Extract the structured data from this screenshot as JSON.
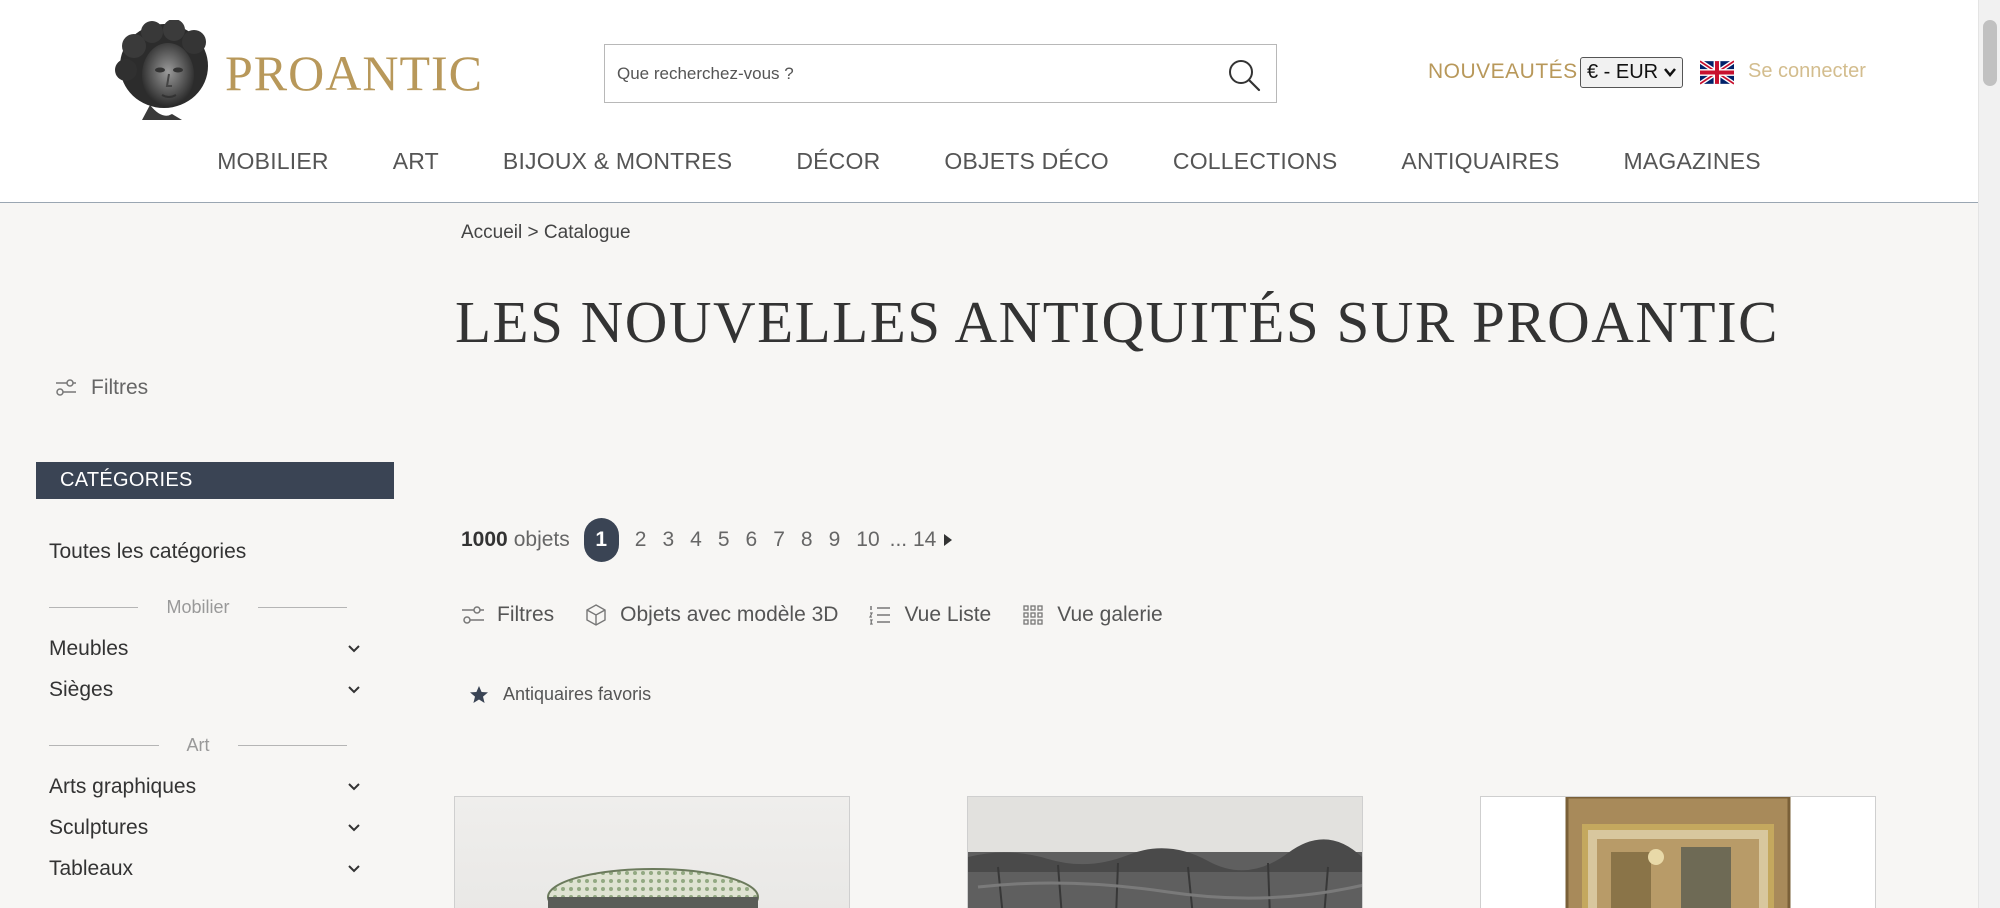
{
  "header": {
    "logo_text": "PROANTIC",
    "search_placeholder": "Que recherchez-vous ?",
    "nouveautes": "NOUVEAUTÉS",
    "currency": "€ - EUR",
    "signin": "Se connecter",
    "accent_color": "#b8985a"
  },
  "nav": [
    "MOBILIER",
    "ART",
    "BIJOUX & MONTRES",
    "DÉCOR",
    "OBJETS DÉCO",
    "COLLECTIONS",
    "ANTIQUAIRES",
    "MAGAZINES"
  ],
  "breadcrumb": "Accueil > Catalogue",
  "title": "LES NOUVELLES ANTIQUITÉS SUR PROANTIC",
  "sidebar": {
    "filters_label": "Filtres",
    "categories_header": "CATÉGORIES",
    "all_categories": "Toutes les catégories",
    "groups": [
      {
        "label": "Mobilier",
        "items": [
          "Meubles",
          "Sièges"
        ]
      },
      {
        "label": "Art",
        "items": [
          "Arts graphiques",
          "Sculptures",
          "Tableaux"
        ]
      }
    ]
  },
  "pager": {
    "count": "1000",
    "count_label": "objets",
    "current": "1",
    "pages": [
      "2",
      "3",
      "4",
      "5",
      "6",
      "7",
      "8",
      "9",
      "10"
    ],
    "last": "... 14"
  },
  "toolbar": {
    "filters": "Filtres",
    "models3d": "Objets avec modèle 3D",
    "list_view": "Vue Liste",
    "gallery_view": "Vue galerie"
  },
  "favorites": "Antiquaires favoris"
}
